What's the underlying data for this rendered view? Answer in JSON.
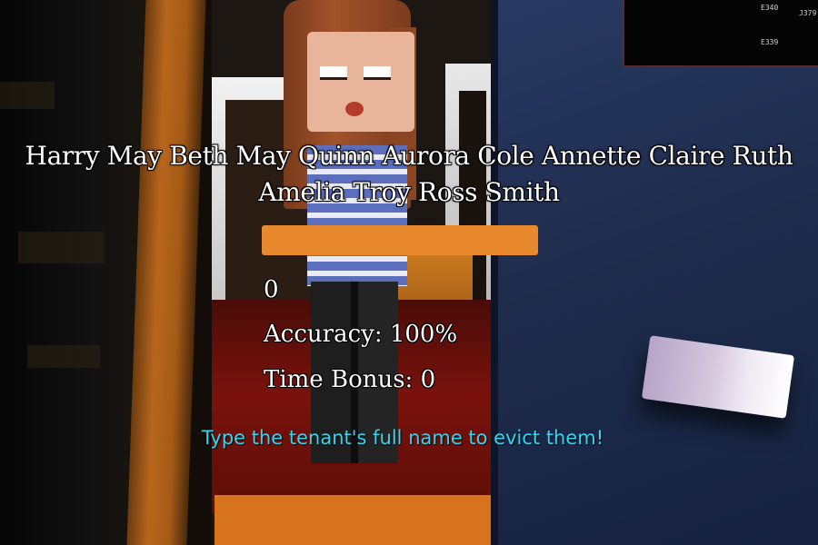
{
  "tenant": {
    "name": "Harry May Beth May Quinn Aurora Cole Annette Claire Ruth Amelia Troy Ross Smith"
  },
  "progress": {
    "fraction": 1.0,
    "color": "#e8892d"
  },
  "stats": {
    "score": "0",
    "accuracy": "Accuracy: 100%",
    "time_bonus": "Time Bonus: 0"
  },
  "instruction": {
    "text": "Type the tenant's full name to evict them!",
    "color": "#2fd7f2"
  },
  "board": {
    "labels": [
      "E340",
      "J379",
      "E339"
    ]
  }
}
